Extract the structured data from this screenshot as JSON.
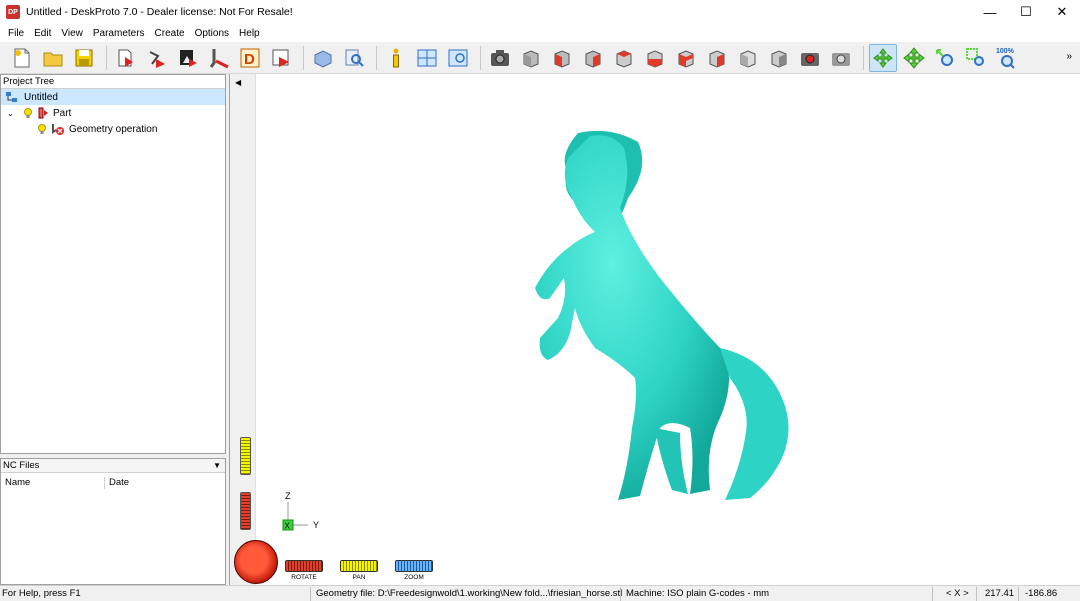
{
  "window": {
    "title": "Untitled - DeskProto 7.0 - Dealer license: Not For Resale!",
    "logo_text": "DP",
    "minimize": "—",
    "maximize": "☐",
    "close": "✕"
  },
  "menu": [
    "File",
    "Edit",
    "View",
    "Parameters",
    "Create",
    "Options",
    "Help"
  ],
  "toolbar": {
    "zoom_label": "100%",
    "more": "»"
  },
  "project_tree": {
    "header": "Project Tree",
    "root": "Untitled",
    "part": "Part",
    "operation": "Geometry operation"
  },
  "nc_files": {
    "header": "NC Files",
    "col_name": "Name",
    "col_date": "Date"
  },
  "viewport": {
    "model": "friesian_horse",
    "model_color": "#2dd3c4",
    "axis_z": "Z",
    "axis_x": "X",
    "axis_y": "Y",
    "rotate": "ROTATE",
    "pan": "PAN",
    "zoom": "ZOOM"
  },
  "status": {
    "help": "For Help, press F1",
    "geometry": "Geometry file: D:\\Freedesignwold\\1.working\\New fold...\\friesian_horse.stl",
    "machine": "Machine: ISO plain G-codes - mm",
    "coords_label": "< X >",
    "x_value": "217.41",
    "y_value": "-186.86"
  }
}
